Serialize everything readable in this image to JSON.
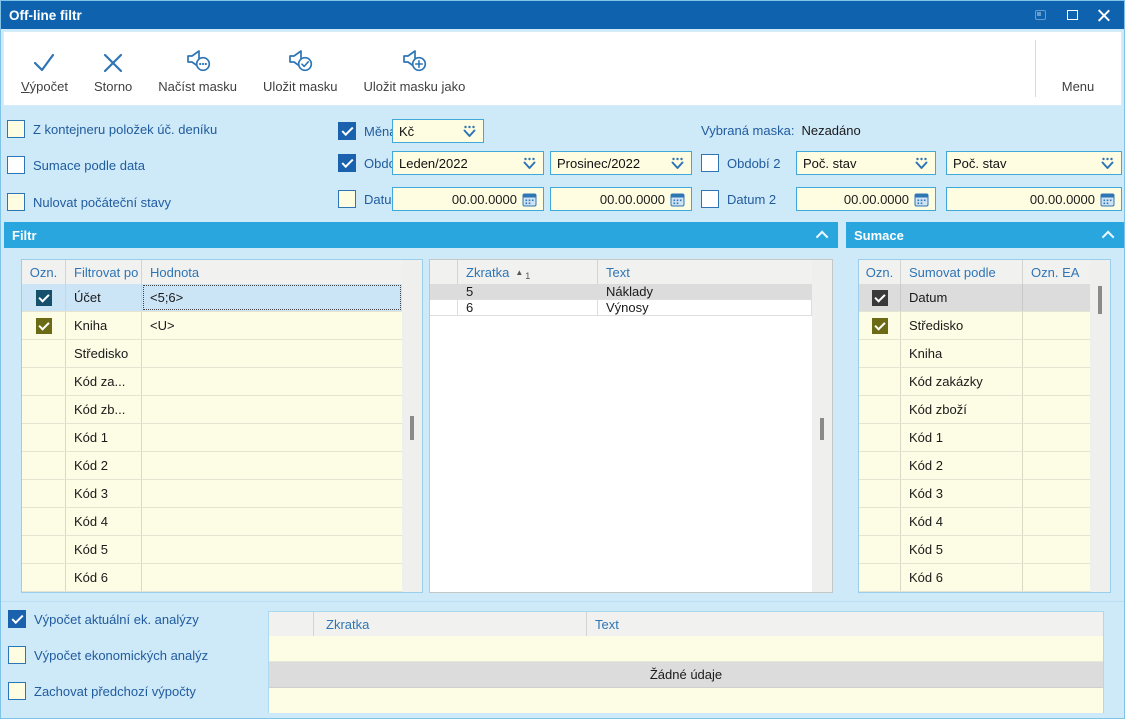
{
  "window": {
    "title": "Off-line filtr"
  },
  "toolbar": {
    "buttons": [
      {
        "label": "Výpočet",
        "icon": "check-icon"
      },
      {
        "label": "Storno",
        "icon": "x-icon"
      },
      {
        "label": "Načíst masku",
        "icon": "mask-load-icon"
      },
      {
        "label": "Uložit masku",
        "icon": "mask-save-icon"
      },
      {
        "label": "Uložit masku jako",
        "icon": "mask-save-as-icon"
      }
    ],
    "menu_label": "Menu"
  },
  "options_left": [
    {
      "label": "Z kontejneru položek úč. deníku",
      "checked": false
    },
    {
      "label": "Sumace podle data",
      "checked": false
    },
    {
      "label": "Nulovat počáteční stavy",
      "checked": false
    }
  ],
  "fields": {
    "mena": {
      "label": "Měna",
      "checked": true,
      "value": "Kč"
    },
    "obdobi": {
      "label": "Období",
      "checked": true,
      "from": "Leden/2022",
      "to": "Prosinec/2022"
    },
    "datum": {
      "label": "Datum",
      "checked": false,
      "from": "00.00.0000",
      "to": "00.00.0000"
    },
    "obdobi2": {
      "label": "Období 2",
      "checked": false,
      "from": "Poč. stav",
      "to": "Poč. stav"
    },
    "datum2": {
      "label": "Datum 2",
      "checked": false,
      "from": "00.00.0000",
      "to": "00.00.0000"
    },
    "maska_label": "Vybraná maska:",
    "maska_value": "Nezadáno"
  },
  "filtr": {
    "title": "Filtr",
    "columns": [
      "Ozn.",
      "Filtrovat po",
      "Hodnota"
    ],
    "rows": [
      {
        "checked": true,
        "name": "Účet",
        "value": "<5;6>",
        "selected": true
      },
      {
        "checked": true,
        "name": "Kniha",
        "value": "<U>",
        "selected": false
      },
      {
        "checked": false,
        "name": "Středisko",
        "value": "",
        "selected": false
      },
      {
        "checked": false,
        "name": "Kód za...",
        "value": "",
        "selected": false
      },
      {
        "checked": false,
        "name": "Kód zb...",
        "value": "",
        "selected": false
      },
      {
        "checked": false,
        "name": "Kód 1",
        "value": "",
        "selected": false
      },
      {
        "checked": false,
        "name": "Kód 2",
        "value": "",
        "selected": false
      },
      {
        "checked": false,
        "name": "Kód 3",
        "value": "",
        "selected": false
      },
      {
        "checked": false,
        "name": "Kód 4",
        "value": "",
        "selected": false
      },
      {
        "checked": false,
        "name": "Kód 5",
        "value": "",
        "selected": false
      },
      {
        "checked": false,
        "name": "Kód 6",
        "value": "",
        "selected": false
      }
    ]
  },
  "lookup": {
    "columns": [
      "Zkratka",
      "Text"
    ],
    "sort_marker": "▲",
    "sort_index": "1",
    "rows": [
      {
        "zkratka": "5",
        "text": "Náklady",
        "selected": true
      },
      {
        "zkratka": "6",
        "text": "Výnosy",
        "selected": false
      }
    ]
  },
  "sumace": {
    "title": "Sumace",
    "columns": [
      "Ozn.",
      "Sumovat podle",
      "Ozn. EA"
    ],
    "rows": [
      {
        "checked": true,
        "name": "Datum",
        "selected": true
      },
      {
        "checked": true,
        "name": "Středisko",
        "selected": false
      },
      {
        "checked": false,
        "name": "Kniha",
        "selected": false
      },
      {
        "checked": false,
        "name": "Kód zakázky",
        "selected": false
      },
      {
        "checked": false,
        "name": "Kód zboží",
        "selected": false
      },
      {
        "checked": false,
        "name": "Kód 1",
        "selected": false
      },
      {
        "checked": false,
        "name": "Kód 2",
        "selected": false
      },
      {
        "checked": false,
        "name": "Kód 3",
        "selected": false
      },
      {
        "checked": false,
        "name": "Kód 4",
        "selected": false
      },
      {
        "checked": false,
        "name": "Kód 5",
        "selected": false
      },
      {
        "checked": false,
        "name": "Kód 6",
        "selected": false
      }
    ]
  },
  "bottom": {
    "options": [
      {
        "label": "Výpočet aktuální ek. analýzy",
        "checked": true
      },
      {
        "label": "Výpočet ekonomických analýz",
        "checked": false
      },
      {
        "label": "Zachovat předchozí výpočty",
        "checked": false
      }
    ],
    "table": {
      "col_zkratka": "Zkratka",
      "col_text": "Text",
      "empty_text": "Žádné údaje"
    }
  },
  "colors": {
    "titlebar-bg": "#0F63AE",
    "body-bg": "#CEE9F8",
    "section-bg": "#2AA6DE",
    "accent": "#2E75B6",
    "label": "#215C9E",
    "field-bg": "#FFFDE1",
    "field-border": "#3FA9DC",
    "cream": "#FDFCE4",
    "sel-blue": "#CBE5F6",
    "sel-gray": "#DCDCDC",
    "cb-blue": "#1A62AE",
    "cb-olive": "#6B6B15",
    "cb-teal": "#17506B",
    "cb-dark": "#3A3A3A"
  }
}
